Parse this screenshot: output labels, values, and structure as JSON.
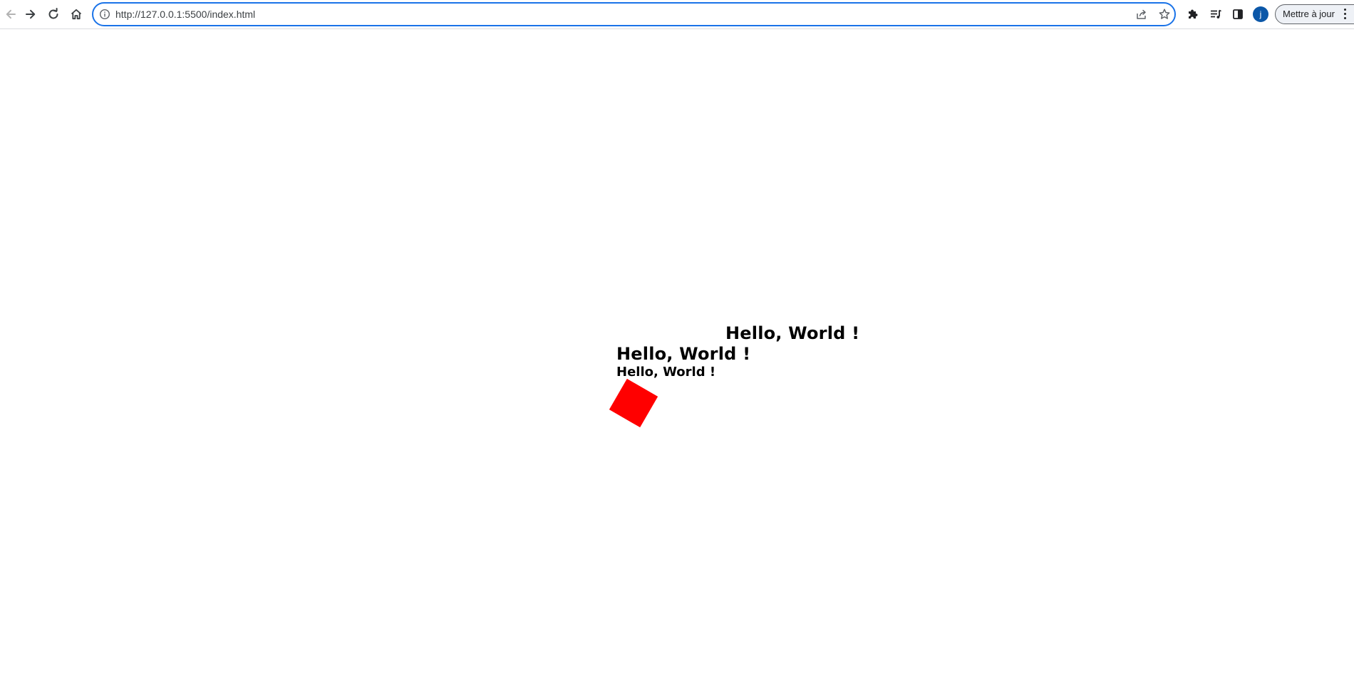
{
  "browser": {
    "url": "http://127.0.0.1:5500/index.html",
    "profile_initial": "j",
    "update_label": "Mettre à jour",
    "icons": {
      "back": "arrow-left-icon",
      "forward": "arrow-right-icon",
      "reload": "reload-icon",
      "home": "home-icon",
      "site_info": "info-icon",
      "share": "share-icon",
      "bookmark": "star-icon",
      "extensions": "puzzle-icon",
      "media": "media-queue-icon",
      "side_panel": "side-panel-icon",
      "menu": "kebab-menu-icon"
    }
  },
  "page": {
    "texts": [
      "Hello, World !",
      "Hello, World !",
      "Hello, World !"
    ],
    "square_color": "#ff0000",
    "square_rotation_deg": 30
  }
}
